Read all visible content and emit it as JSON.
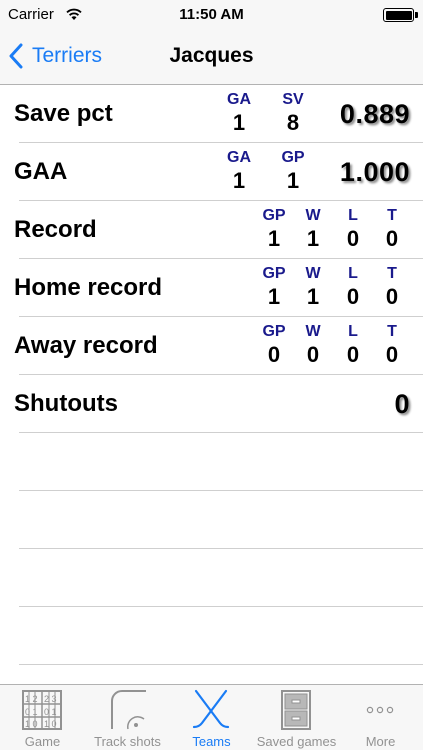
{
  "status_bar": {
    "carrier": "Carrier",
    "time": "11:50 AM"
  },
  "nav": {
    "back_label": "Terriers",
    "title": "Jacques"
  },
  "stats": {
    "save_pct": {
      "label": "Save pct",
      "headers": [
        "GA",
        "SV"
      ],
      "values": [
        "1",
        "8"
      ],
      "result": "0.889"
    },
    "gaa": {
      "label": "GAA",
      "headers": [
        "GA",
        "GP"
      ],
      "values": [
        "1",
        "1"
      ],
      "result": "1.000"
    },
    "record": {
      "label": "Record",
      "headers": [
        "GP",
        "W",
        "L",
        "T"
      ],
      "values": [
        "1",
        "1",
        "0",
        "0"
      ]
    },
    "home_record": {
      "label": "Home record",
      "headers": [
        "GP",
        "W",
        "L",
        "T"
      ],
      "values": [
        "1",
        "1",
        "0",
        "0"
      ]
    },
    "away_record": {
      "label": "Away record",
      "headers": [
        "GP",
        "W",
        "L",
        "T"
      ],
      "values": [
        "0",
        "0",
        "0",
        "0"
      ]
    },
    "shutouts": {
      "label": "Shutouts",
      "result": "0"
    }
  },
  "tabs": [
    {
      "label": "Game",
      "icon": "scoreboard-icon",
      "active": false
    },
    {
      "label": "Track shots",
      "icon": "rink-icon",
      "active": false
    },
    {
      "label": "Teams",
      "icon": "hockey-sticks-icon",
      "active": true
    },
    {
      "label": "Saved games",
      "icon": "filing-cabinet-icon",
      "active": false
    },
    {
      "label": "More",
      "icon": "more-dots-icon",
      "active": false
    }
  ],
  "colors": {
    "accent": "#1a7cf5",
    "header_blue": "#1a1a8c",
    "inactive_tab": "#929292"
  }
}
